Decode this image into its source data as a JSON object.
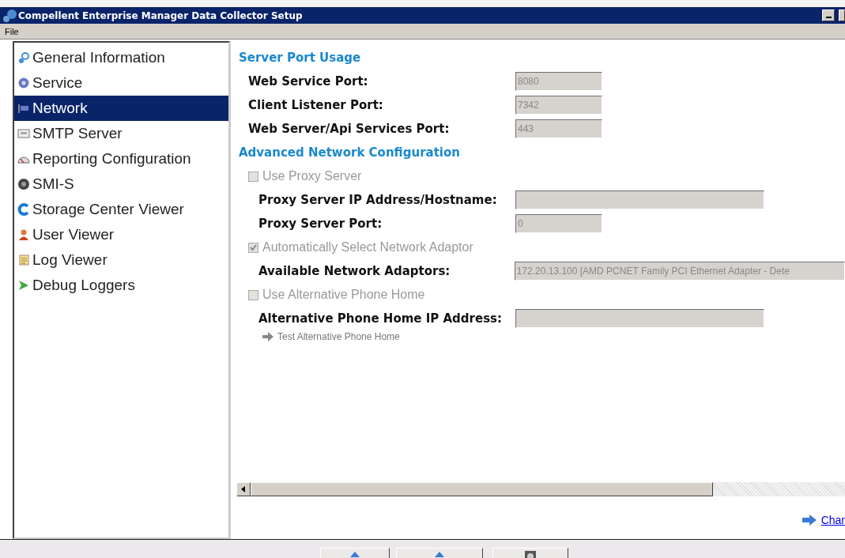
{
  "window": {
    "title": "Compellent Enterprise Manager Data Collector Setup"
  },
  "menu": [
    "File"
  ],
  "sidebar": {
    "items": [
      {
        "label": "General Information",
        "selected": false,
        "kind": "info"
      },
      {
        "label": "Service",
        "selected": false,
        "kind": "service"
      },
      {
        "label": "Network",
        "selected": true,
        "kind": "network"
      },
      {
        "label": "SMTP Server",
        "selected": false,
        "kind": "smtp"
      },
      {
        "label": "Reporting Configuration",
        "selected": false,
        "kind": "reporting"
      },
      {
        "label": "SMI-S",
        "selected": false,
        "kind": "smis"
      },
      {
        "label": "Storage Center Viewer",
        "selected": false,
        "kind": "storage"
      },
      {
        "label": "User Viewer",
        "selected": false,
        "kind": "user"
      },
      {
        "label": "Log Viewer",
        "selected": false,
        "kind": "log"
      },
      {
        "label": "Debug Loggers",
        "selected": false,
        "kind": "debug"
      }
    ]
  },
  "content": [
    {
      "kind": "heading",
      "text": "Server Port Usage"
    },
    {
      "kind": "port",
      "label": "Web Service Port:",
      "value": "8080"
    },
    {
      "kind": "port",
      "label": "Client Listener Port:",
      "value": "7342"
    },
    {
      "kind": "port",
      "label": "Web Server/Api Services Port:",
      "value": "443"
    },
    {
      "kind": "heading",
      "text": "Advanced Network Configuration"
    },
    {
      "kind": "checkbox",
      "label": "Use Proxy Server",
      "checked": false,
      "children": [
        {
          "kind": "address",
          "label": "Proxy Server IP Address/Hostname:"
        },
        {
          "kind": "port",
          "label": "Proxy Server Port:",
          "value": "0"
        }
      ]
    },
    {
      "kind": "checkbox",
      "label": "Automatically Select Network Adaptor",
      "checked": true,
      "children": [
        {
          "kind": "adaptor",
          "label": "Available Network Adaptors:",
          "value": "172.20.13.100 [AMD PCNET Family PCI Ethernet Adapter - Dete"
        }
      ]
    },
    {
      "kind": "checkbox",
      "label": "Use Alternative Phone Home",
      "checked": false,
      "children": [
        {
          "kind": "address",
          "label": "Alternative Phone Home IP Address:"
        },
        {
          "kind": "link",
          "label": "Test Alternative Phone Home"
        }
      ]
    }
  ],
  "footer_link": "Char",
  "buttons": [
    {
      "kind": "ok"
    },
    {
      "kind": "cancel"
    },
    {
      "kind": "help"
    }
  ]
}
